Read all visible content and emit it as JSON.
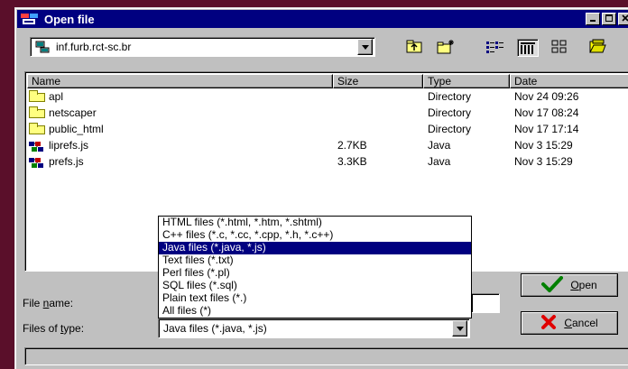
{
  "window": {
    "title": "Open file"
  },
  "look_in": {
    "value": "inf.furb.rct-sc.br"
  },
  "toolbar": {
    "icons": [
      "up-folder-icon",
      "new-folder-icon",
      "list-view-icon",
      "details-view-icon",
      "large-icons-view-icon",
      "open-folder-icon"
    ]
  },
  "columns": {
    "name": "Name",
    "size": "Size",
    "type": "Type",
    "date": "Date"
  },
  "files": [
    {
      "name": "apl",
      "size": "",
      "type": "Directory",
      "date": "Nov 24 09:26",
      "icon": "folder-icon"
    },
    {
      "name": "netscaper",
      "size": "",
      "type": "Directory",
      "date": "Nov 17 08:24",
      "icon": "folder-icon"
    },
    {
      "name": "public_html",
      "size": "",
      "type": "Directory",
      "date": "Nov 17 17:14",
      "icon": "folder-icon"
    },
    {
      "name": "liprefs.js",
      "size": "2.7KB",
      "type": "Java",
      "date": "Nov 3 15:29",
      "icon": "java-file-icon"
    },
    {
      "name": "prefs.js",
      "size": "3.3KB",
      "type": "Java",
      "date": "Nov 3 15:29",
      "icon": "java-file-icon"
    }
  ],
  "file_name": {
    "label_pre": "File ",
    "label_ul": "n",
    "label_post": "ame:",
    "value": ""
  },
  "file_type": {
    "label_pre": "Files of ",
    "label_ul": "t",
    "label_post": "ype:",
    "value": "Java files (*.java, *.js)",
    "options": [
      "HTML files (*.html, *.htm, *.shtml)",
      "C++ files (*.c, *.cc, *.cpp, *.h, *.c++)",
      "Java files (*.java, *.js)",
      "Text files (*.txt)",
      "Perl files (*.pl)",
      "SQL files (*.sql)",
      "Plain text files (*.)",
      "All files (*)"
    ],
    "selected_index": 2
  },
  "buttons": {
    "open_ul": "O",
    "open_rest": "pen",
    "cancel_ul": "C",
    "cancel_rest": "ancel"
  },
  "colors": {
    "titlebar": "#000080",
    "selection": "#000080",
    "desktop": "#5a0f2a",
    "face": "#c0c0c0"
  }
}
